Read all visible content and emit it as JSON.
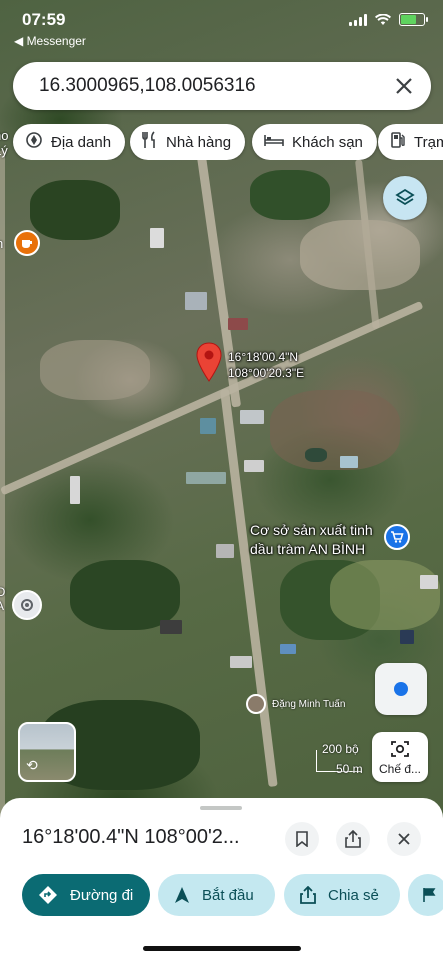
{
  "status_bar": {
    "time": "07:59",
    "back_app": "◀ Messenger"
  },
  "search": {
    "query": "16.3000965,108.0056316"
  },
  "chips": [
    {
      "label": "Địa danh",
      "icon": "landmark-icon"
    },
    {
      "label": "Nhà hàng",
      "icon": "fork-knife-icon"
    },
    {
      "label": "Khách sạn",
      "icon": "bed-icon"
    },
    {
      "label": "Trạm",
      "icon": "fuel-icon"
    }
  ],
  "map": {
    "pin_coords_line1": "16°18'00.4\"N",
    "pin_coords_line2": "108°00'20.3\"E",
    "poi_line1": "Cơ sở sản xuất tinh",
    "poi_line2": "dầu tràm AN BÌNH",
    "left_label_top": "ho\nLý",
    "left_label_mid": "n",
    "left_label_bottom": "O\nA",
    "user_name": "Đặng Minh Tuấn",
    "scale_top": "200 bộ",
    "scale_bottom": "50 m",
    "capture_label": "Chế đ..."
  },
  "sheet": {
    "title": "16°18'00.4\"N 108°00'2...",
    "actions": [
      {
        "label": "Đường đi",
        "icon": "directions-icon"
      },
      {
        "label": "Bắt đầu",
        "icon": "navigation-arrow-icon"
      },
      {
        "label": "Chia sẻ",
        "icon": "share-icon"
      }
    ]
  },
  "colors": {
    "primary": "#0b6b73",
    "secondary": "#c4e8f0",
    "pin": "#ea4335",
    "blue": "#1a73e8"
  }
}
